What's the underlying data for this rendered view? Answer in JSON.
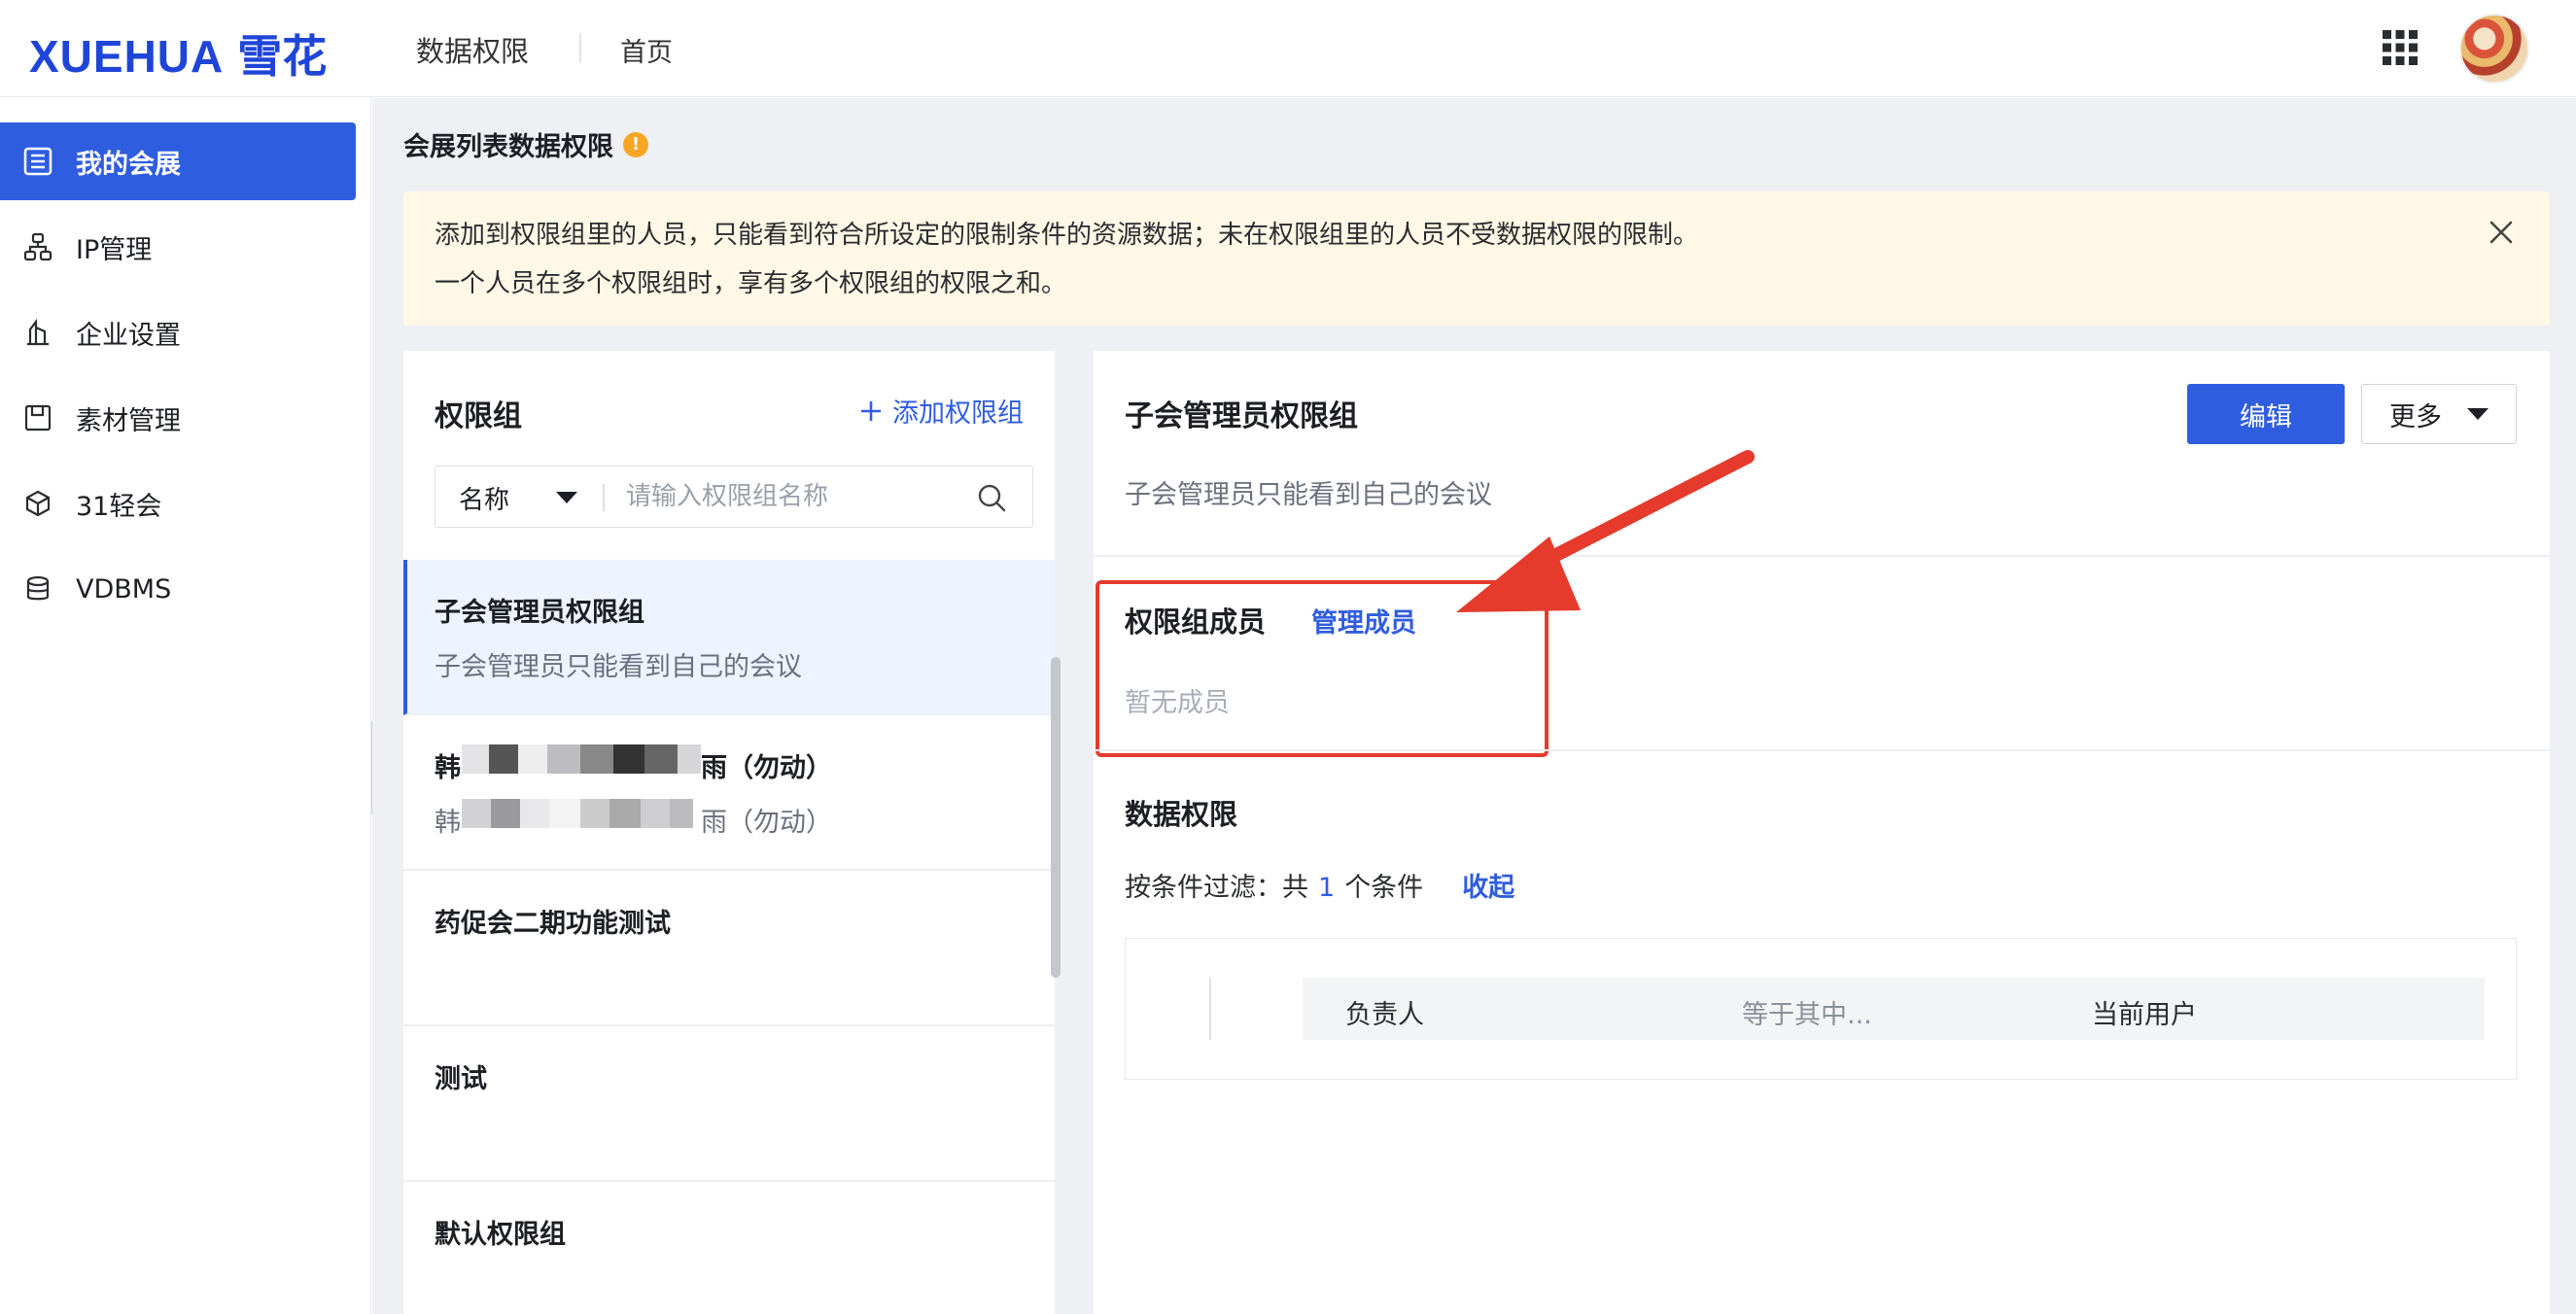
{
  "header": {
    "logo_text": "XUEHUA",
    "logo_cn": "雪花",
    "app_title": "数据权限",
    "home": "首页"
  },
  "sidebar": {
    "items": [
      {
        "label": "我的会展",
        "icon": "list-icon",
        "active": true
      },
      {
        "label": "IP管理",
        "icon": "org-tree-icon",
        "active": false
      },
      {
        "label": "企业设置",
        "icon": "building-icon",
        "active": false
      },
      {
        "label": "素材管理",
        "icon": "save-icon",
        "active": false
      },
      {
        "label": "31轻会",
        "icon": "cube-icon",
        "active": false
      },
      {
        "label": "VDBMS",
        "icon": "database-icon",
        "active": false
      }
    ]
  },
  "page": {
    "title": "会展列表数据权限",
    "title_badge": "!"
  },
  "notice": {
    "line1": "添加到权限组里的人员，只能看到符合所设定的限制条件的资源数据；未在权限组里的人员不受数据权限的限制。",
    "line2": "一个人员在多个权限组时，享有多个权限组的权限之和。"
  },
  "groups_panel": {
    "title": "权限组",
    "add_label": "添加权限组",
    "search": {
      "select_value": "名称",
      "placeholder": "请输入权限组名称"
    },
    "items": [
      {
        "name": "子会管理员权限组",
        "desc": "子会管理员只能看到自己的会议",
        "active": true
      },
      {
        "name": "韩",
        "name_suffix": "雨（勿动）",
        "desc": "韩",
        "desc_suffix": "雨（勿动）",
        "active": false
      },
      {
        "name": "药促会二期功能测试",
        "desc": "",
        "active": false
      },
      {
        "name": "测试",
        "desc": "",
        "active": false
      },
      {
        "name": "默认权限组",
        "desc": "",
        "active": false
      }
    ]
  },
  "detail": {
    "title": "子会管理员权限组",
    "edit_label": "编辑",
    "more_label": "更多",
    "desc": "子会管理员只能看到自己的会议",
    "members_label": "权限组成员",
    "manage_label": "管理成员",
    "no_members": "暂无成员",
    "data_title": "数据权限",
    "filter_prefix": "按条件过滤：共",
    "filter_count": "1",
    "filter_suffix": "个条件",
    "collapse_label": "收起",
    "condition": {
      "field": "负责人",
      "operator": "等于其中...",
      "value": "当前用户"
    }
  },
  "colors": {
    "primary": "#2f5de0",
    "annotation": "#e53a2c",
    "notice_bg": "#fff8e6"
  }
}
